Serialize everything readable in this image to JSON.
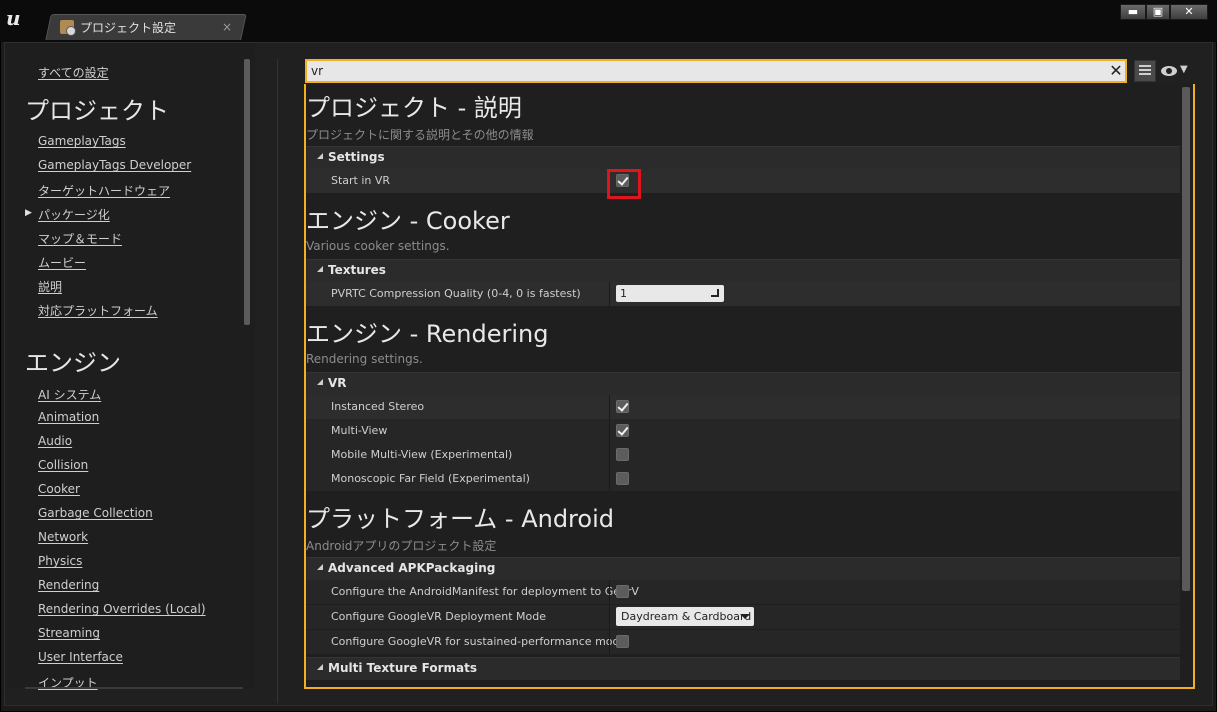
{
  "window": {
    "tab_label": "プロジェクト設定",
    "tab_close": "×",
    "minimize": "▬",
    "maximize": "▣",
    "close": "✕",
    "logo": "u"
  },
  "sidebar": {
    "all_settings": "すべての設定",
    "project_heading": "プロジェクト",
    "project_items": [
      "GameplayTags",
      "GameplayTags Developer",
      "ターゲットハードウェア",
      "パッケージ化",
      "マップ＆モード",
      "ムービー",
      "説明",
      "対応プラットフォーム"
    ],
    "engine_heading": "エンジン",
    "engine_items": [
      "AI システム",
      "Animation",
      "Audio",
      "Collision",
      "Cooker",
      "Garbage Collection",
      "Network",
      "Physics",
      "Rendering",
      "Rendering Overrides (Local)",
      "Streaming",
      "User Interface",
      "インプット"
    ]
  },
  "search": {
    "value": "vr",
    "clear": "✕"
  },
  "sections": {
    "project": {
      "title": "プロジェクト - 説明",
      "desc": "プロジェクトに関する説明とその他の情報",
      "category": "Settings",
      "rows": [
        {
          "label": "Start in VR",
          "checked": true
        }
      ]
    },
    "cooker": {
      "title": "エンジン - Cooker",
      "desc": "Various cooker settings.",
      "category": "Textures",
      "rows": [
        {
          "label": "PVRTC Compression Quality (0-4, 0 is fastest)",
          "value": "1"
        }
      ]
    },
    "rendering": {
      "title": "エンジン - Rendering",
      "desc": "Rendering settings.",
      "category": "VR",
      "rows": [
        {
          "label": "Instanced Stereo",
          "checked": true
        },
        {
          "label": "Multi-View",
          "checked": true
        },
        {
          "label": "Mobile Multi-View (Experimental)",
          "checked": false
        },
        {
          "label": "Monoscopic Far Field (Experimental)",
          "checked": false
        }
      ]
    },
    "android": {
      "title": "プラットフォーム - Android",
      "desc": "Androidアプリのプロジェクト設定",
      "category": "Advanced APKPackaging",
      "rows": [
        {
          "label": "Configure the AndroidManifest for deployment to GearV",
          "checked": false
        },
        {
          "label": "Configure GoogleVR Deployment Mode",
          "value": "Daydream & Cardboard"
        },
        {
          "label": "Configure GoogleVR for sustained-performance mode",
          "checked": false
        }
      ],
      "category2": "Multi Texture Formats"
    }
  }
}
